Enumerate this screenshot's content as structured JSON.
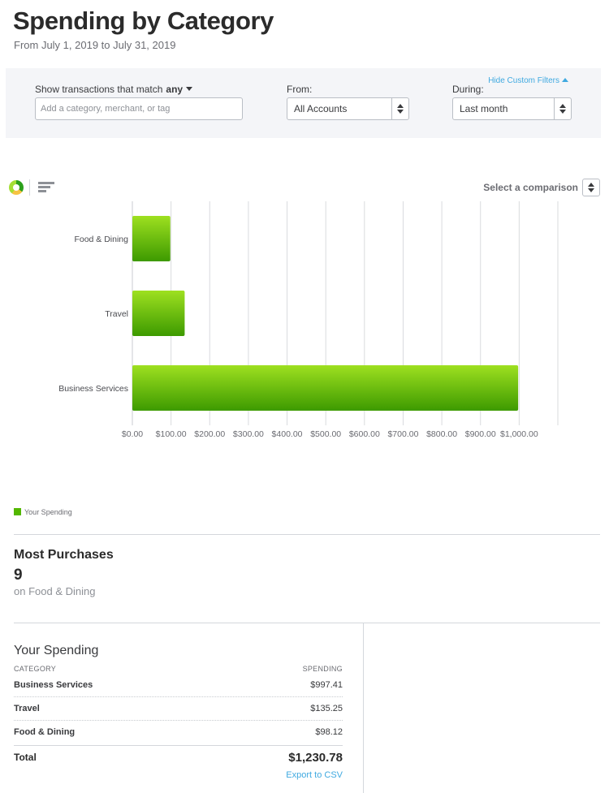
{
  "header": {
    "title": "Spending by Category",
    "subtitle": "From July 1, 2019 to July 31, 2019"
  },
  "filters": {
    "hide_label": "Hide Custom Filters",
    "match_label": "Show transactions that match",
    "match_value": "any",
    "search_placeholder": "Add a category, merchant, or tag",
    "from_label": "From:",
    "from_value": "All Accounts",
    "during_label": "During:",
    "during_value": "Last month"
  },
  "toolbar": {
    "comparison_label": "Select a comparison"
  },
  "colors": {
    "bar_light": "#9ee020",
    "bar_dark": "#3d9a00",
    "legend": "#53b700",
    "link": "#3fa9e0"
  },
  "chart_data": {
    "type": "bar",
    "orientation": "horizontal",
    "categories": [
      "Food & Dining",
      "Travel",
      "Business Services"
    ],
    "series": [
      {
        "name": "Your Spending",
        "values": [
          98.12,
          135.25,
          997.41
        ]
      }
    ],
    "xlim": [
      0,
      1100
    ],
    "x_ticks": [
      0,
      100,
      200,
      300,
      400,
      500,
      600,
      700,
      800,
      900,
      1000
    ],
    "x_tick_labels": [
      "$0.00",
      "$100.00",
      "$200.00",
      "$300.00",
      "$400.00",
      "$500.00",
      "$600.00",
      "$700.00",
      "$800.00",
      "$900.00",
      "$1,000.00"
    ],
    "grid": "vertical",
    "legend": "bottom-left"
  },
  "legend": {
    "label": "Your Spending"
  },
  "most_purchases": {
    "title": "Most Purchases",
    "count": "9",
    "subtitle": "on Food & Dining"
  },
  "spending_table": {
    "title": "Your Spending",
    "col_category": "CATEGORY",
    "col_spending": "SPENDING",
    "rows": [
      {
        "category": "Business Services",
        "amount": "$997.41"
      },
      {
        "category": "Travel",
        "amount": "$135.25"
      },
      {
        "category": "Food & Dining",
        "amount": "$98.12"
      }
    ],
    "total_label": "Total",
    "total_value": "$1,230.78",
    "export_label": "Export to CSV"
  }
}
